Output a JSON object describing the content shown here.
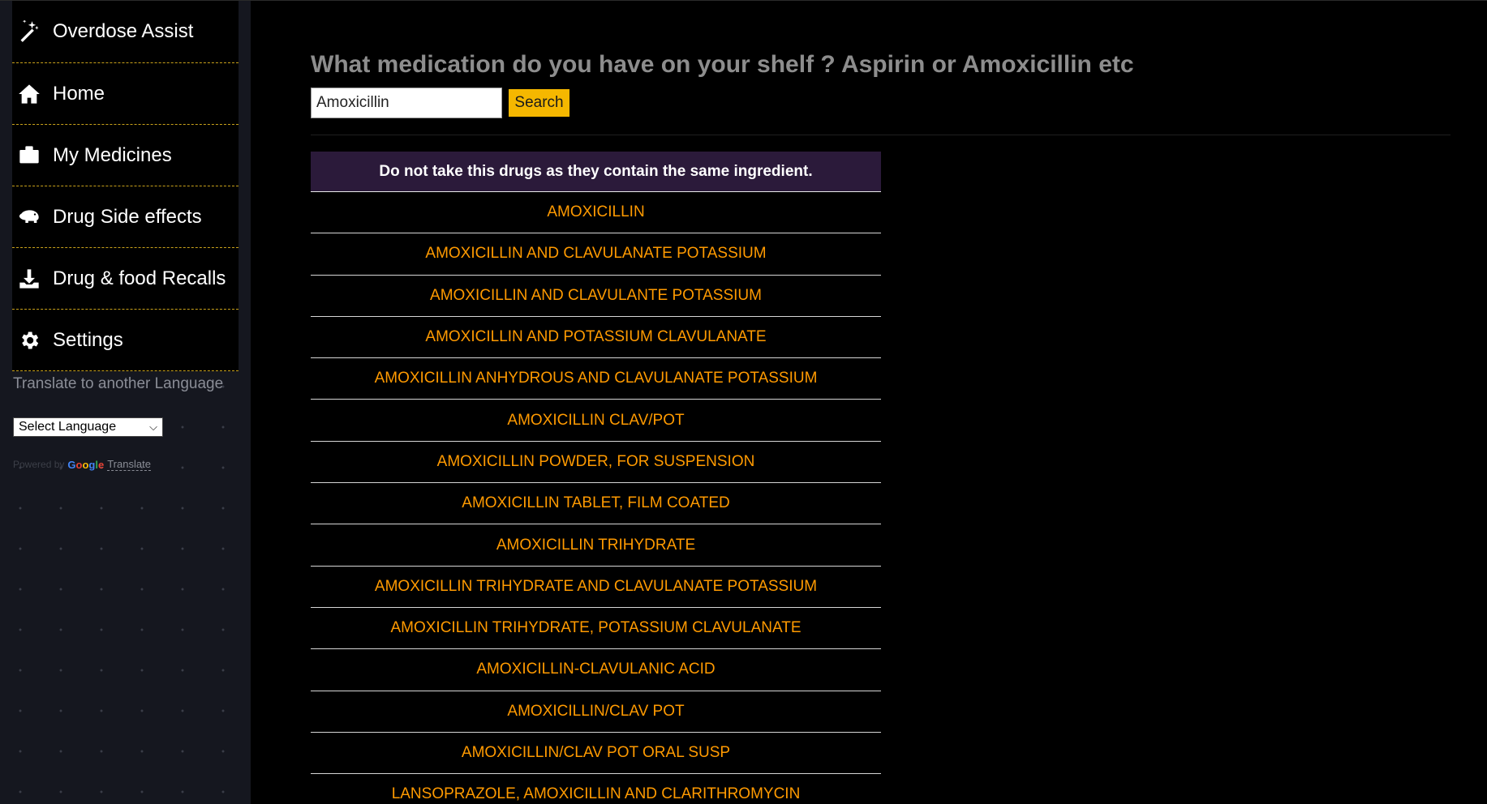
{
  "sidebar": {
    "brand": {
      "label": "Overdose Assist",
      "icon": "magic-wand-icon"
    },
    "items": [
      {
        "label": "Home",
        "icon": "home-icon"
      },
      {
        "label": "My Medicines",
        "icon": "medicine-kit-icon"
      },
      {
        "label": "Drug Side effects",
        "icon": "hippo-icon"
      },
      {
        "label": "Drug & food Recalls",
        "icon": "download-icon"
      },
      {
        "label": "Settings",
        "icon": "gear-icon"
      }
    ],
    "translate_label": "Translate to another Language",
    "language_select": {
      "selected": "Select Language"
    },
    "powered_by": {
      "prefix": "Powered by",
      "google": "Google",
      "link": "Translate"
    }
  },
  "main": {
    "headline": "What medication do you have on your shelf ? Aspirin or Amoxicillin etc",
    "search": {
      "value": "Amoxicillin",
      "button_label": "Search"
    },
    "results": {
      "header": "Do not take this drugs as they contain the same ingredient.",
      "rows": [
        "AMOXICILLIN",
        "AMOXICILLIN AND CLAVULANATE POTASSIUM",
        "AMOXICILLIN AND CLAVULANTE POTASSIUM",
        "AMOXICILLIN AND POTASSIUM CLAVULANATE",
        "AMOXICILLIN ANHYDROUS AND CLAVULANATE POTASSIUM",
        "AMOXICILLIN CLAV/POT",
        "AMOXICILLIN POWDER, FOR SUSPENSION",
        "AMOXICILLIN TABLET, FILM COATED",
        "AMOXICILLIN TRIHYDRATE",
        "AMOXICILLIN TRIHYDRATE AND CLAVULANATE POTASSIUM",
        "AMOXICILLIN TRIHYDRATE, POTASSIUM CLAVULANATE",
        "AMOXICILLIN-CLAVULANIC ACID",
        "AMOXICILLIN/CLAV POT",
        "AMOXICILLIN/CLAV POT ORAL SUSP",
        "LANSOPRAZOLE, AMOXICILLIN AND CLARITHROMYCIN"
      ]
    }
  },
  "colors": {
    "accent": "#f5b700",
    "result_text": "#ff9a00",
    "header_bg": "#2b1a3a",
    "sidebar_bg": "#15171f",
    "menu_divider": "#c9a21a"
  }
}
